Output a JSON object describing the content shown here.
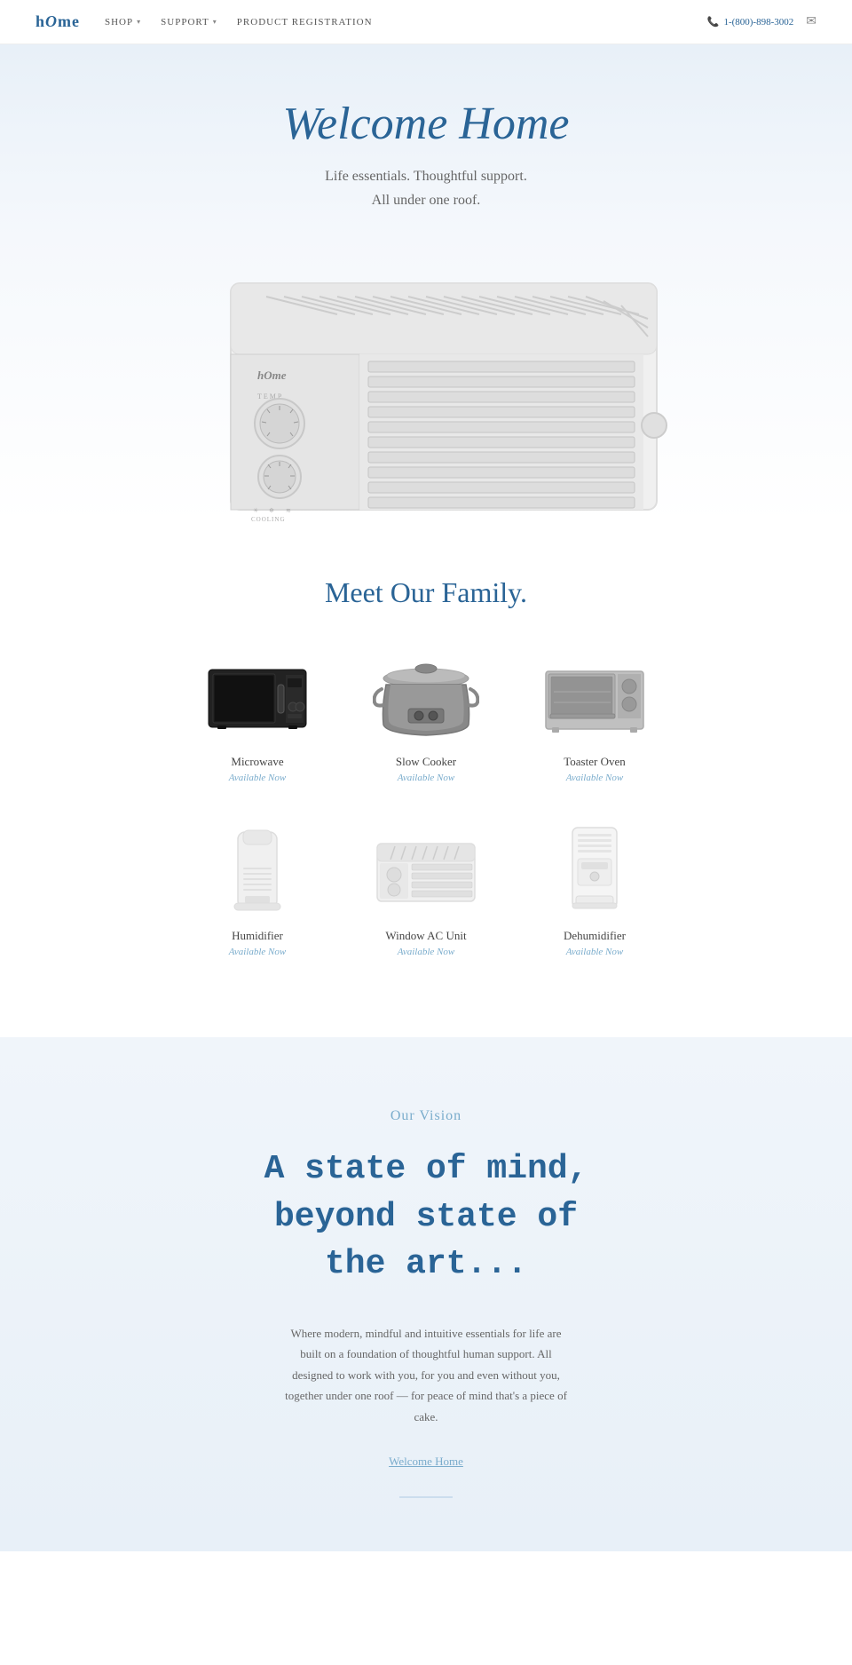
{
  "nav": {
    "logo": "hOme",
    "links": [
      {
        "label": "SHOP",
        "has_dropdown": true
      },
      {
        "label": "SUPPORT",
        "has_dropdown": true
      },
      {
        "label": "PRODUCT REGISTRATION",
        "has_dropdown": false
      }
    ],
    "phone": "1-(800)-898-3002",
    "phone_icon": "📞",
    "email_icon": "✉"
  },
  "hero": {
    "title": "Welcome Home",
    "subtitle_line1": "Life essentials. Thoughtful support.",
    "subtitle_line2": "All under one roof."
  },
  "meet_family": {
    "title": "Meet Our Family.",
    "products_row1": [
      {
        "name": "Microwave",
        "status": "Available Now"
      },
      {
        "name": "Slow Cooker",
        "status": "Available Now"
      },
      {
        "name": "Toaster Oven",
        "status": "Available Now"
      }
    ],
    "products_row2": [
      {
        "name": "Humidifier",
        "status": "Available Now"
      },
      {
        "name": "Window AC Unit",
        "status": "Available Now"
      },
      {
        "name": "Dehumidifier",
        "status": "Available Now"
      }
    ]
  },
  "vision": {
    "label": "Our Vision",
    "title_line1": "A state of mind,",
    "title_line2": "beyond state of",
    "title_line3": "the art...",
    "body": "Where modern, mindful and intuitive essentials for life are built on a foundation of thoughtful human support. All designed to work with you, for you and even without you, together under one roof — for peace of mind that's a piece of cake.",
    "cta": "Welcome Home"
  }
}
